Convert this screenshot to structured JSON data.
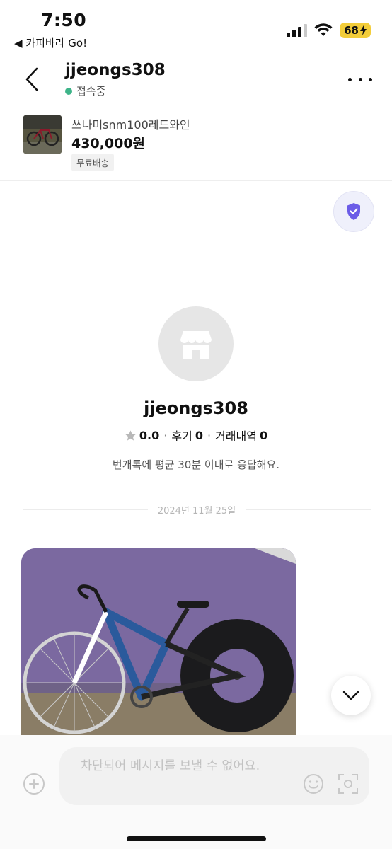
{
  "status_bar": {
    "time": "7:50",
    "back_app": "◀ 카피바라 Go!",
    "battery": "68"
  },
  "header": {
    "username": "jjeongs308",
    "status": "접속중"
  },
  "product": {
    "name": "쓰나미snm100레드와인",
    "price": "430,000원",
    "badge": "무료배송"
  },
  "profile": {
    "name": "jjeongs308",
    "rating": "0.0",
    "reviews_label": "후기",
    "reviews": "0",
    "transactions_label": "거래내역",
    "transactions": "0",
    "response_note": "번개톡에 평균 30분 이내로 응답해요."
  },
  "chat": {
    "date": "2024년 11월 25일"
  },
  "input": {
    "placeholder": "차단되어 메시지를 보낼 수 없어요."
  },
  "colors": {
    "online": "#3eb489",
    "shield": "#6b5ce7",
    "battery": "#f3cd3a"
  }
}
